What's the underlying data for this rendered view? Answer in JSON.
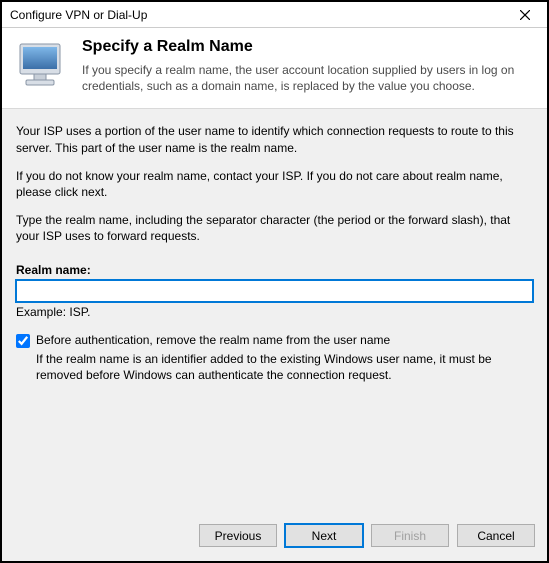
{
  "window": {
    "title": "Configure VPN or Dial-Up"
  },
  "header": {
    "heading": "Specify a Realm Name",
    "subtext": "If you specify a realm name, the user account location supplied by users in log on credentials, such as a domain name, is replaced by the value you choose."
  },
  "body": {
    "para1": "Your ISP uses a portion of the user name to identify which connection requests to route to this server. This part of the user name is the realm name.",
    "para2": "If you do not know your realm name, contact your ISP. If you do not care about realm name, please click next.",
    "para3": "Type the realm name, including the separator character (the period or the forward slash), that your ISP uses to forward requests.",
    "realm_label": "Realm name:",
    "realm_value": "",
    "realm_example": "Example: ISP.",
    "checkbox_label": "Before authentication, remove the realm name from the user name",
    "checkbox_checked": true,
    "checkbox_help": "If the realm name is an identifier added to the existing Windows user name, it must be removed before Windows can authenticate the connection request."
  },
  "footer": {
    "previous": "Previous",
    "next": "Next",
    "finish": "Finish",
    "cancel": "Cancel"
  }
}
